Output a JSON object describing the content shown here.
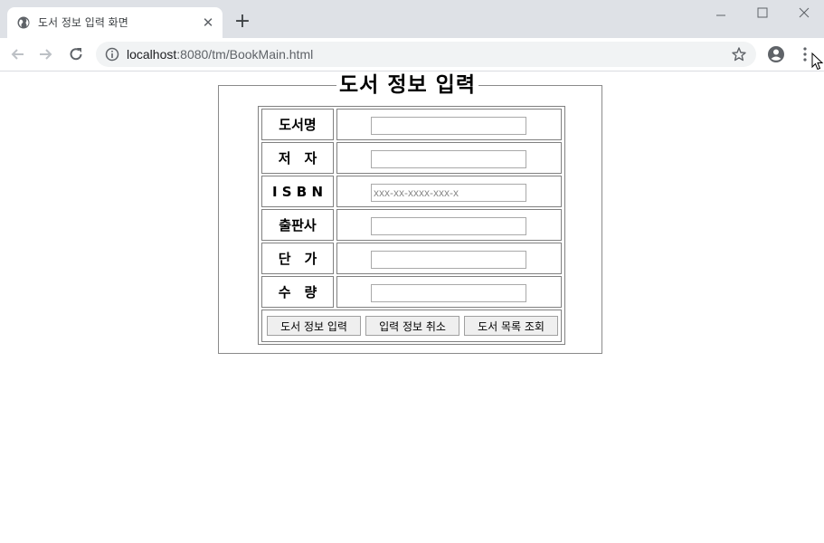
{
  "browser": {
    "tab_title": "도서 정보 입력 화면",
    "url_host": "localhost",
    "url_rest": ":8080/tm/BookMain.html"
  },
  "form": {
    "legend": "도서 정보 입력",
    "fields": [
      {
        "label": "도서명",
        "value": "",
        "placeholder": ""
      },
      {
        "label": "저　자",
        "value": "",
        "placeholder": ""
      },
      {
        "label": "I S B N",
        "value": "",
        "placeholder": "xxx-xx-xxxx-xxx-x"
      },
      {
        "label": "출판사",
        "value": "",
        "placeholder": ""
      },
      {
        "label": "단　가",
        "value": "",
        "placeholder": ""
      },
      {
        "label": "수　량",
        "value": "",
        "placeholder": ""
      }
    ],
    "buttons": {
      "submit": "도서 정보 입력",
      "reset": "입력 정보 취소",
      "list": "도서 목록 조회"
    }
  }
}
